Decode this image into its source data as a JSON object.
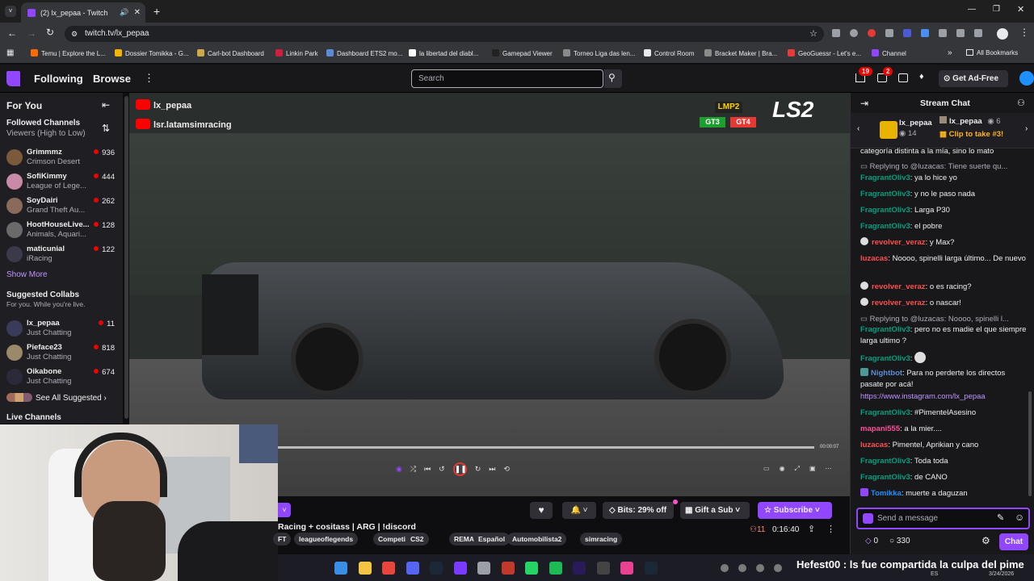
{
  "browser": {
    "tab_title": "(2) lx_pepaa - Twitch",
    "url": "twitch.tv/lx_pepaa",
    "bookmarks": [
      {
        "label": "Temu | Explore the L...",
        "color": "#ff6a00"
      },
      {
        "label": "Dossier Tomikka - G...",
        "color": "#f4b400"
      },
      {
        "label": "Carl-bot Dashboard",
        "color": "#cfa84a"
      },
      {
        "label": "Linkin Park",
        "color": "#d01f3c"
      },
      {
        "label": "Dashboard ETS2 mo...",
        "color": "#5b8bd6"
      },
      {
        "label": "la libertad del diabl...",
        "color": "#ffffff"
      },
      {
        "label": "Gamepad Viewer",
        "color": "#222222"
      },
      {
        "label": "Torneo Liga das len...",
        "color": "#8a8a8a"
      },
      {
        "label": "Control Room",
        "color": "#e8eaed"
      },
      {
        "label": "Bracket Maker | Bra...",
        "color": "#8a8a8a"
      },
      {
        "label": "GeoGuessr - Let's e...",
        "color": "#e83a3a"
      },
      {
        "label": "Channel",
        "color": "#9146ff"
      }
    ],
    "all_bookmarks": "All Bookmarks"
  },
  "nav": {
    "following": "Following",
    "browse": "Browse",
    "search_placeholder": "Search",
    "notif_count": "19",
    "whisper_count": "2",
    "ad_free": "Get Ad-Free"
  },
  "sidebar": {
    "for_you": "For You",
    "followed_title": "Followed Channels",
    "followed_sort": "Viewers (High to Low)",
    "channels": [
      {
        "name": "Grimmmz",
        "game": "Crimson Desert",
        "viewers": "936",
        "color": "#7a5a3a"
      },
      {
        "name": "SofiKimmy",
        "game": "League of Lege...",
        "viewers": "444",
        "color": "#c98aa8"
      },
      {
        "name": "SoyDairi",
        "game": "Grand Theft Au...",
        "viewers": "262",
        "color": "#8a6a5a"
      },
      {
        "name": "HootHouseLive...",
        "game": "Animals, Aquari...",
        "viewers": "128",
        "color": "#6a6a6a"
      },
      {
        "name": "maticunial",
        "game": "iRacing",
        "viewers": "122",
        "color": "#3a3a4a"
      }
    ],
    "show_more": "Show More",
    "suggested_title": "Suggested Collabs",
    "suggested_sub": "For you. While you're live.",
    "suggested": [
      {
        "name": "lx_pepaa",
        "game": "Just Chatting",
        "viewers": "11",
        "color": "#3a3a5a"
      },
      {
        "name": "Pieface23",
        "game": "Just Chatting",
        "viewers": "818",
        "color": "#9a8a6a"
      },
      {
        "name": "Oikabone",
        "game": "Just Chatting",
        "viewers": "674",
        "color": "#2a2a3a"
      }
    ],
    "see_all": "See All Suggested",
    "live_channels": "Live Channels"
  },
  "video": {
    "overlay_name": "lx_pepaa",
    "overlay_channel": "lsr.latamsimracing",
    "class1": "LMP2",
    "class2": "GT3",
    "class3": "GT4",
    "logo": "LS2",
    "time": "00:00:07"
  },
  "info": {
    "title": "Racing + cositass | ARG | !discord",
    "bits": "Bits: 29% off",
    "gift": "Gift a Sub",
    "subscribe": "Subscribe",
    "viewers": "11",
    "uptime": "0:16:40",
    "tags": [
      "FT",
      "leagueoflegends",
      "Competitivo",
      "CS2",
      "REMATCH",
      "Español",
      "Automobilista2",
      "simracing"
    ]
  },
  "chat": {
    "title": "Stream Chat",
    "pinned_user": "lx_pepaa",
    "pinned_count": "14",
    "pinned_user2": "lx_pepaa",
    "pinned_count2": "6",
    "clip_text": "Clip to take #3!",
    "top_text": "categoría distinta a la mía, sino lo mato",
    "messages": [
      {
        "type": "reply",
        "text": "Replying to @luzacas: Tiene suerte qu..."
      },
      {
        "user": "FragrantOliv3",
        "cls": "u-g",
        "text": ": ya lo hice yo"
      },
      {
        "user": "FragrantOliv3",
        "cls": "u-g",
        "text": ": y no le paso nada"
      },
      {
        "user": "FragrantOliv3",
        "cls": "u-g",
        "text": ": Larga P30"
      },
      {
        "user": "FragrantOliv3",
        "cls": "u-g",
        "text": ": el pobre"
      },
      {
        "user": "revolver_veraz",
        "cls": "u-r",
        "text": ": y Max?"
      },
      {
        "user": "luzacas",
        "cls": "u-r",
        "text": ": Noooo, spinelli larga último... De nuevo"
      },
      {
        "user": "revolver_veraz",
        "cls": "u-r",
        "text": ": o es racing?"
      },
      {
        "user": "revolver_veraz",
        "cls": "u-r",
        "text": ": o nascar!"
      },
      {
        "type": "reply",
        "text": "Replying to @luzacas: Noooo, spinelli l..."
      },
      {
        "user": "FragrantOliv3",
        "cls": "u-g",
        "text": ": pero no es madie el que siempre larga ultimo ?"
      },
      {
        "user": "FragrantOliv3",
        "cls": "u-g",
        "text": ":"
      },
      {
        "user": "Nightbot",
        "cls": "u-n",
        "text": ": Para no perderte los directos pasate por acá!"
      },
      {
        "type": "link",
        "text": "https://www.instagram.com/lx_pepaa"
      },
      {
        "user": "FragrantOliv3",
        "cls": "u-g",
        "text": ": #PimentelAsesino"
      },
      {
        "user": "mapani555",
        "cls": "u-m",
        "text": ": a la mier...."
      },
      {
        "user": "luzacas",
        "cls": "u-r",
        "text": ": Pimentel, Aprikian y cano"
      },
      {
        "user": "FragrantOliv3",
        "cls": "u-g",
        "text": ": Toda toda"
      },
      {
        "user": "FragrantOliv3",
        "cls": "u-g",
        "text": ": de CANO"
      },
      {
        "user": "Tomikka",
        "cls": "u-b",
        "text": ": muerte a daguzan"
      }
    ],
    "input_placeholder": "Send a message",
    "points": "0",
    "channel_points": "330",
    "chat_button": "Chat"
  },
  "taskbar": {
    "ticker": "Hefest00 : ls fue compartida la culpa del pime",
    "lang": "ES",
    "date": "3/24/2026"
  }
}
